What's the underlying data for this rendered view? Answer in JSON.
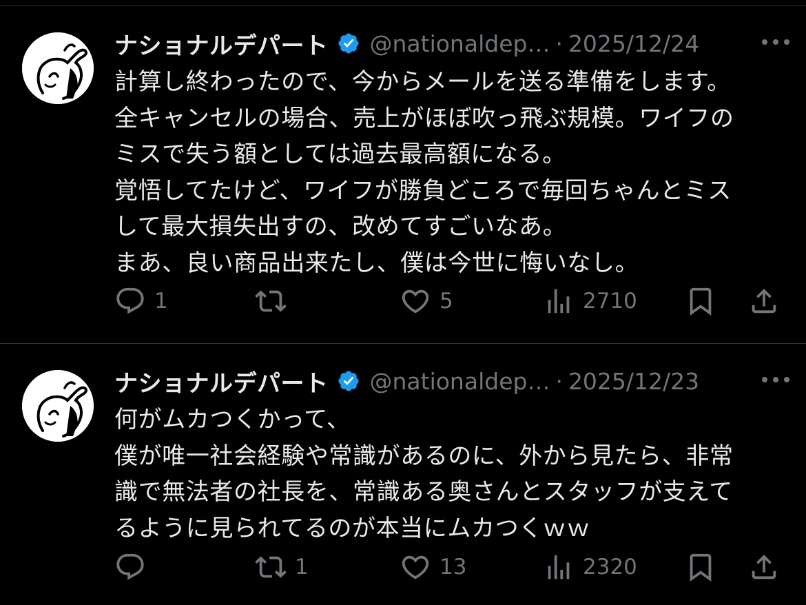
{
  "tweets": [
    {
      "author_name": "ナショナルデパート",
      "handle": "@nationaldep…",
      "separator": "·",
      "date": "2025/12/24",
      "text_lines": [
        "計算し終わったので、今からメールを送る準備をします。",
        "全キャンセルの場合、売上がほぼ吹っ飛ぶ規模。ワイフの",
        "ミスで失う額としては過去最高額になる。",
        "覚悟してたけど、ワイフが勝負どころで毎回ちゃんとミス",
        "して最大損失出すの、改めてすごいなあ。",
        "まあ、良い商品出来たし、僕は今世に悔いなし。"
      ],
      "reply_count": "1",
      "retweet_count": "",
      "like_count": "5",
      "view_count": "2710"
    },
    {
      "author_name": "ナショナルデパート",
      "handle": "@nationaldep…",
      "separator": "·",
      "date": "2025/12/23",
      "text_lines": [
        "何がムカつくかって、",
        "僕が唯一社会経験や常識があるのに、外から見たら、非常",
        "識で無法者の社長を、常識ある奥さんとスタッフが支えて",
        "るように見られてるのが本当にムカつくｗｗ"
      ],
      "reply_count": "",
      "retweet_count": "1",
      "like_count": "13",
      "view_count": "2320"
    }
  ],
  "icons": {
    "verified": "verified-badge-icon",
    "more": "more-options-icon",
    "reply": "reply-icon",
    "retweet": "retweet-icon",
    "like": "heart-icon",
    "views": "views-chart-icon",
    "bookmark": "bookmark-icon",
    "share": "share-icon"
  },
  "colors": {
    "background": "#000000",
    "text_primary": "#e7e9ea",
    "text_secondary": "#71767b",
    "divider": "#2f3336",
    "verified_blue": "#1d9bf0"
  }
}
